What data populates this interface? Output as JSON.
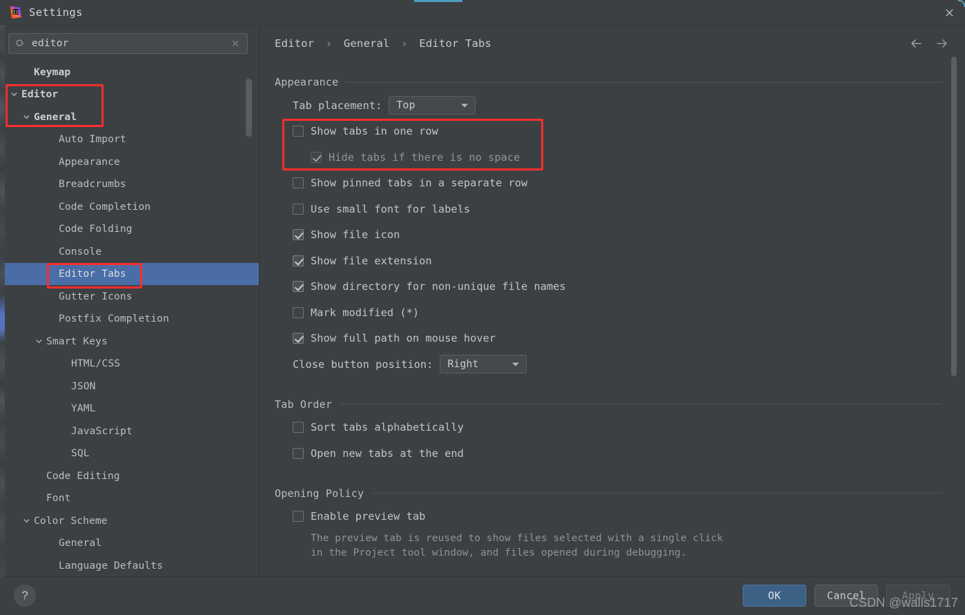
{
  "window": {
    "title": "Settings",
    "logo_icon": "intellij-idea-logo",
    "close_icon": "close-icon"
  },
  "search": {
    "value": "editor",
    "placeholder": "",
    "icon": "search-icon",
    "clear_icon": "clear-icon"
  },
  "sidebar": {
    "items": [
      {
        "label": "Keymap",
        "indent": 1,
        "twisty": "none",
        "selected": false,
        "bold": true
      },
      {
        "label": "Editor",
        "indent": 0,
        "twisty": "expanded",
        "selected": false,
        "bold": true
      },
      {
        "label": "General",
        "indent": 1,
        "twisty": "expanded",
        "selected": false,
        "bold": true
      },
      {
        "label": "Auto Import",
        "indent": 3,
        "twisty": "none",
        "selected": false,
        "bold": false
      },
      {
        "label": "Appearance",
        "indent": 3,
        "twisty": "none",
        "selected": false,
        "bold": false
      },
      {
        "label": "Breadcrumbs",
        "indent": 3,
        "twisty": "none",
        "selected": false,
        "bold": false
      },
      {
        "label": "Code Completion",
        "indent": 3,
        "twisty": "none",
        "selected": false,
        "bold": false
      },
      {
        "label": "Code Folding",
        "indent": 3,
        "twisty": "none",
        "selected": false,
        "bold": false
      },
      {
        "label": "Console",
        "indent": 3,
        "twisty": "none",
        "selected": false,
        "bold": false
      },
      {
        "label": "Editor Tabs",
        "indent": 3,
        "twisty": "none",
        "selected": true,
        "bold": false
      },
      {
        "label": "Gutter Icons",
        "indent": 3,
        "twisty": "none",
        "selected": false,
        "bold": false
      },
      {
        "label": "Postfix Completion",
        "indent": 3,
        "twisty": "none",
        "selected": false,
        "bold": false
      },
      {
        "label": "Smart Keys",
        "indent": 2,
        "twisty": "expanded",
        "selected": false,
        "bold": false
      },
      {
        "label": "HTML/CSS",
        "indent": 4,
        "twisty": "none",
        "selected": false,
        "bold": false
      },
      {
        "label": "JSON",
        "indent": 4,
        "twisty": "none",
        "selected": false,
        "bold": false
      },
      {
        "label": "YAML",
        "indent": 4,
        "twisty": "none",
        "selected": false,
        "bold": false
      },
      {
        "label": "JavaScript",
        "indent": 4,
        "twisty": "none",
        "selected": false,
        "bold": false
      },
      {
        "label": "SQL",
        "indent": 4,
        "twisty": "none",
        "selected": false,
        "bold": false
      },
      {
        "label": "Code Editing",
        "indent": 2,
        "twisty": "none",
        "selected": false,
        "bold": false
      },
      {
        "label": "Font",
        "indent": 2,
        "twisty": "none",
        "selected": false,
        "bold": false
      },
      {
        "label": "Color Scheme",
        "indent": 1,
        "twisty": "expanded",
        "selected": false,
        "bold": false
      },
      {
        "label": "General",
        "indent": 3,
        "twisty": "none",
        "selected": false,
        "bold": false
      },
      {
        "label": "Language Defaults",
        "indent": 3,
        "twisty": "none",
        "selected": false,
        "bold": false
      }
    ]
  },
  "breadcrumb": {
    "part1": "Editor",
    "sep1": "›",
    "part2": "General",
    "sep2": "›",
    "part3": "Editor Tabs"
  },
  "nav": {
    "back_icon": "arrow-left-icon",
    "forward_icon": "arrow-right-icon"
  },
  "sections": {
    "appearance": {
      "title": "Appearance",
      "tab_placement_label": "Tab placement:",
      "tab_placement_value": "Top",
      "close_button_label": "Close button position:",
      "close_button_value": "Right",
      "checkboxes": [
        {
          "label": "Show tabs in one row",
          "checked": false,
          "disabled": false,
          "indent": 1
        },
        {
          "label": "Hide tabs if there is no space",
          "checked": true,
          "disabled": true,
          "indent": 2
        },
        {
          "label": "Show pinned tabs in a separate row",
          "checked": false,
          "disabled": false,
          "indent": 1
        },
        {
          "label": "Use small font for labels",
          "checked": false,
          "disabled": false,
          "indent": 1
        },
        {
          "label": "Show file icon",
          "checked": true,
          "disabled": false,
          "indent": 1
        },
        {
          "label": "Show file extension",
          "checked": true,
          "disabled": false,
          "indent": 1
        },
        {
          "label": "Show directory for non-unique file names",
          "checked": true,
          "disabled": false,
          "indent": 1
        },
        {
          "label": "Mark modified (*)",
          "checked": false,
          "disabled": false,
          "indent": 1
        },
        {
          "label": "Show full path on mouse hover",
          "checked": true,
          "disabled": false,
          "indent": 1
        }
      ]
    },
    "tab_order": {
      "title": "Tab Order",
      "checkboxes": [
        {
          "label": "Sort tabs alphabetically",
          "checked": false,
          "disabled": false,
          "indent": 1
        },
        {
          "label": "Open new tabs at the end",
          "checked": false,
          "disabled": false,
          "indent": 1
        }
      ]
    },
    "opening_policy": {
      "title": "Opening Policy",
      "checkboxes": [
        {
          "label": "Enable preview tab",
          "checked": false,
          "disabled": false,
          "indent": 1
        }
      ],
      "description_line1": "The preview tab is reused to show files selected with a single click",
      "description_line2": "in the Project tool window, and files opened during debugging."
    }
  },
  "footer": {
    "help_label": "?",
    "ok_label": "OK",
    "cancel_label": "Cancel",
    "apply_label": "Apply"
  },
  "watermark": "CSDN @walls1717",
  "colors": {
    "accent_selection": "#4a6da7",
    "primary_button": "#3d6185",
    "annotation_red": "#ff2d2d",
    "panel_bg": "#3c4043"
  }
}
